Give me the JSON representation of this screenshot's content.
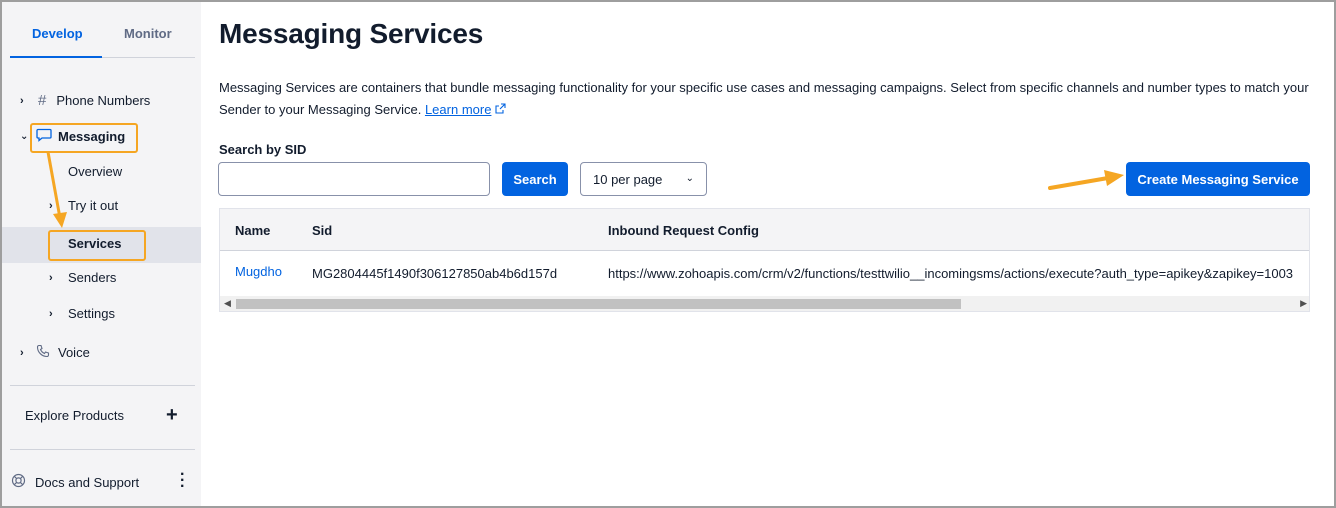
{
  "sidebar": {
    "tabs": {
      "develop": "Develop",
      "monitor": "Monitor"
    },
    "phone_numbers": "Phone Numbers",
    "messaging": "Messaging",
    "overview": "Overview",
    "try_it_out": "Try it out",
    "services": "Services",
    "senders": "Senders",
    "settings": "Settings",
    "voice": "Voice",
    "explore_products": "Explore Products",
    "docs_support": "Docs and Support"
  },
  "main": {
    "title": "Messaging Services",
    "description": "Messaging Services are containers that bundle messaging functionality for your specific use cases and messaging campaigns. Select from specific channels and number types to match your Sender to your Messaging Service.",
    "learn_more": "Learn more",
    "search_label": "Search by SID",
    "search_value": "",
    "search_button": "Search",
    "per_page": "10 per page",
    "create_button": "Create Messaging Service",
    "table": {
      "headers": [
        "Name",
        "Sid",
        "Inbound Request Config"
      ],
      "rows": [
        {
          "name": "Mugdho",
          "sid": "MG2804445f1490f306127850ab4b6d157d",
          "config": "https://www.zohoapis.com/crm/v2/functions/testtwilio__incomingsms/actions/execute?auth_type=apikey&zapikey=1003"
        }
      ]
    }
  },
  "colors": {
    "accent": "#0263e0",
    "highlight": "#f5a623",
    "sidebar_bg": "#f4f4f6"
  }
}
